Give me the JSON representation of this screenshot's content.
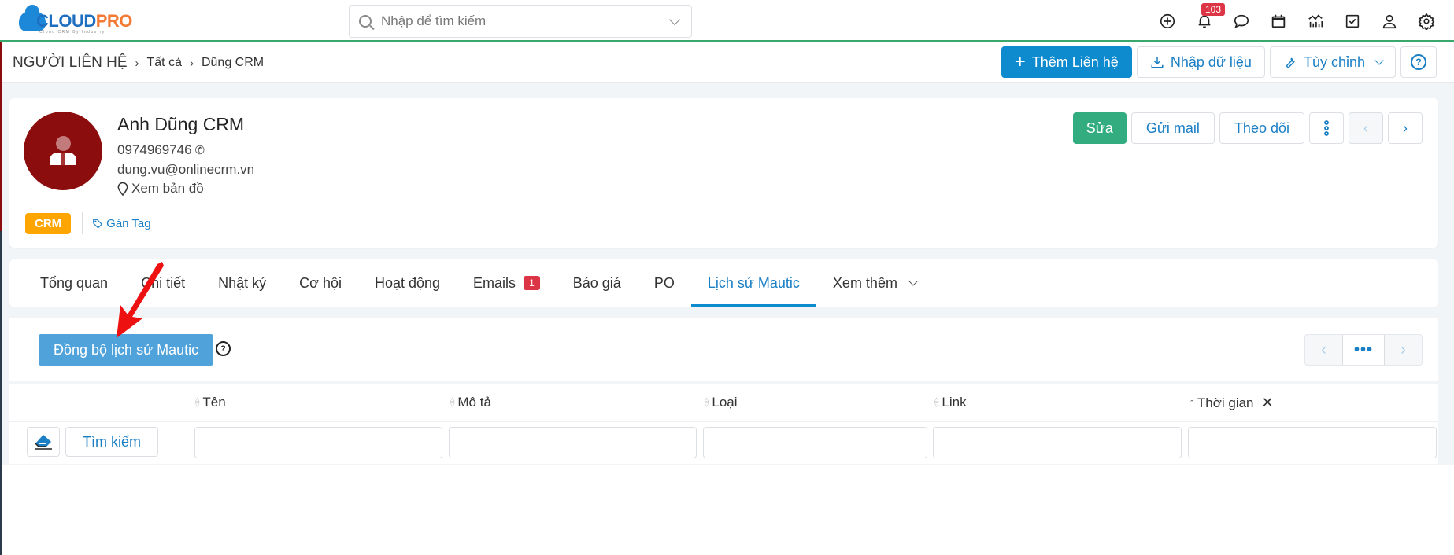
{
  "header": {
    "logo": {
      "part1": "CLOUD",
      "part2": "PRO",
      "tagline": "Cloud CRM By Industry"
    },
    "search": {
      "placeholder": "Nhập để tìm kiếm",
      "value": ""
    },
    "icons": [
      "add-icon",
      "bell-icon",
      "chat-icon",
      "calendar-icon",
      "chart-icon",
      "task-icon",
      "user-icon",
      "gear-icon"
    ],
    "notification_count": "103"
  },
  "breadcrumb": {
    "root": "NGƯỜI LIÊN HỆ",
    "items": [
      "Tất cả",
      "Dũng CRM"
    ]
  },
  "actions": {
    "add": "Thêm Liên hệ",
    "import": "Nhập dữ liệu",
    "customize": "Tùy chỉnh"
  },
  "profile": {
    "name": "Anh Dũng CRM",
    "phone": "0974969746",
    "email": "dung.vu@onlinecrm.vn",
    "map": "Xem bản đồ",
    "tag": "CRM",
    "assign_tag": "Gán Tag",
    "buttons": {
      "edit": "Sửa",
      "send_mail": "Gửi mail",
      "follow": "Theo dõi"
    }
  },
  "tabs": [
    {
      "label": "Tổng quan"
    },
    {
      "label": "Chi tiết"
    },
    {
      "label": "Nhật ký"
    },
    {
      "label": "Cơ hội"
    },
    {
      "label": "Hoạt động"
    },
    {
      "label": "Emails",
      "count": "1"
    },
    {
      "label": "Báo giá"
    },
    {
      "label": "PO"
    },
    {
      "label": "Lịch sử Mautic",
      "active": true
    },
    {
      "label": "Xem thêm"
    }
  ],
  "panel": {
    "sync_button": "Đồng bộ lịch sử Mautic",
    "pager_more": "•••",
    "columns": [
      "Tên",
      "Mô tả",
      "Loại",
      "Link",
      "Thời gian"
    ],
    "search_button": "Tìm kiếm",
    "filters": [
      "",
      "",
      "",
      "",
      ""
    ]
  },
  "colors": {
    "primary": "#0e8ace",
    "success": "#33ad7f",
    "tag": "#ffa500",
    "danger": "#dc3545",
    "avatar": "#8b0d0d"
  }
}
